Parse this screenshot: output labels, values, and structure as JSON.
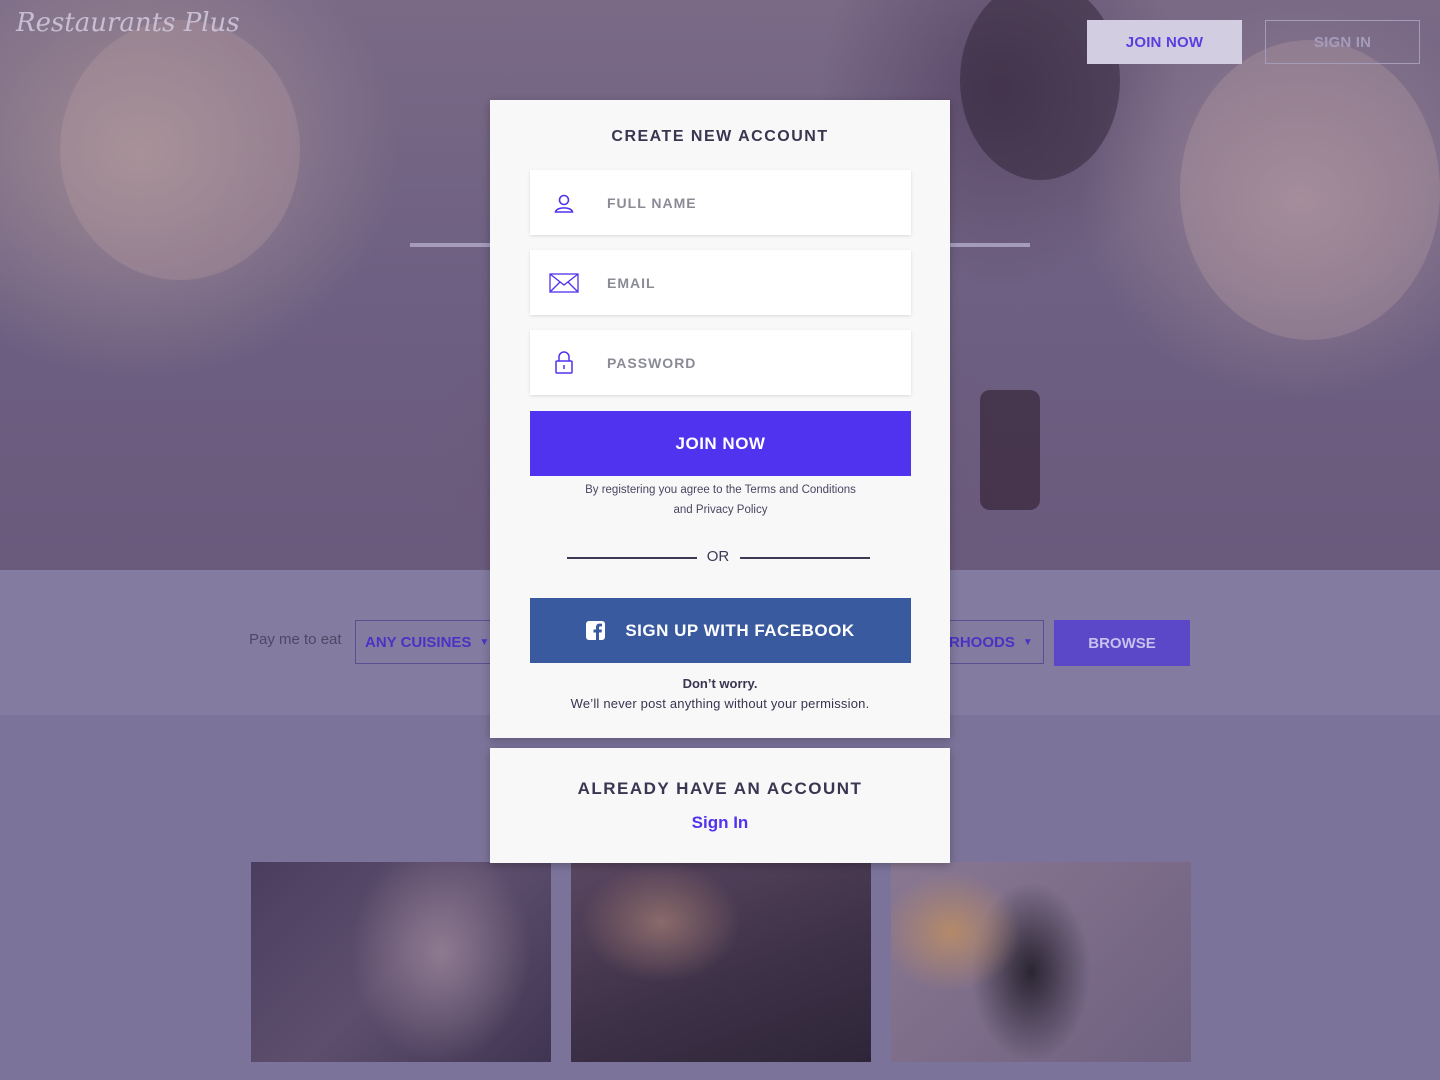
{
  "app": {
    "logo_text": "Restaurants Plus"
  },
  "header": {
    "join_label": "JOIN NOW",
    "signin_label": "SIGN IN"
  },
  "search": {
    "label": "Pay me to eat",
    "cuisine_value": "ANY CUISINES",
    "neighborhood_value": "RHOODS",
    "browse_label": "BROWSE"
  },
  "modal": {
    "title": "CREATE NEW ACCOUNT",
    "full_name_placeholder": "FULL NAME",
    "email_placeholder": "EMAIL",
    "password_placeholder": "PASSWORD",
    "join_label": "JOIN NOW",
    "terms_line1": "By registering you agree to the Terms and Conditions",
    "terms_line2": "and Privacy Policy",
    "or_text": "OR",
    "facebook_label": "SIGN UP WITH FACEBOOK",
    "worry_title": "Don’t worry.",
    "worry_text": "We’ll never post anything without your permission."
  },
  "signin_panel": {
    "title": "ALREADY HAVE AN ACCOUNT",
    "link_label": "Sign In"
  },
  "icons": {
    "user": "user-icon",
    "email": "envelope-icon",
    "password": "lock-icon",
    "facebook": "facebook-icon",
    "caret": "caret-down-icon"
  },
  "colors": {
    "accent": "#4f33ee",
    "facebook": "#3a5aa0",
    "overlay": "#7a7296",
    "text_dark": "#3a3550"
  }
}
